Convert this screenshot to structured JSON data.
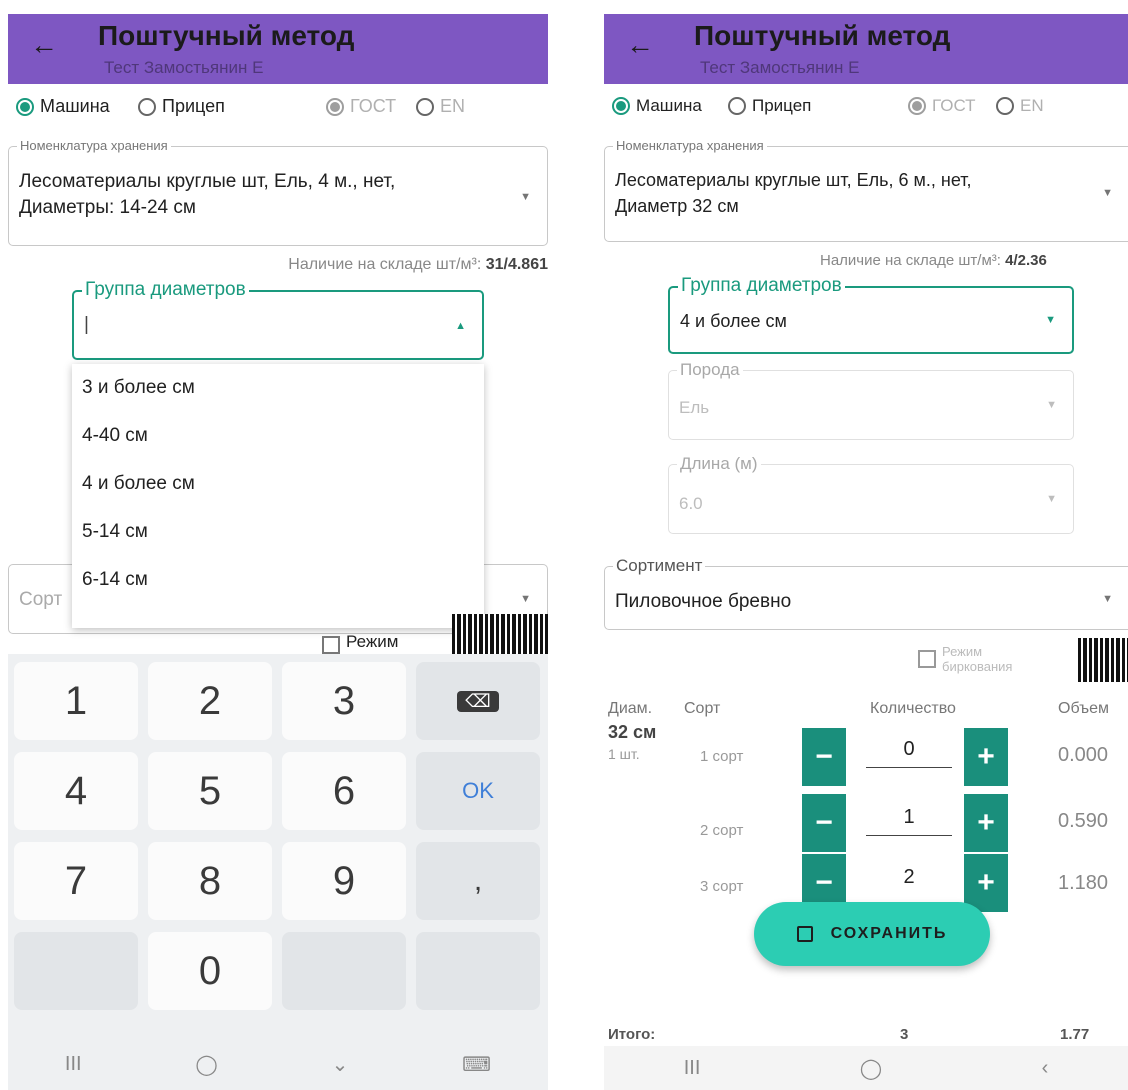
{
  "app": {
    "back_icon": "←",
    "title": "Поштучный метод",
    "subtitle": "Тест Замостьянин Е",
    "accent_color": "#7e57c2",
    "teal_color": "#1a9a7e"
  },
  "radios": {
    "machine": "Машина",
    "trailer": "Прицеп",
    "gost": "ГОСТ",
    "en": "EN"
  },
  "left": {
    "nomenclature_label": "Номенклатура хранения",
    "nomenclature_value": "Лесоматериалы круглые шт, Ель, 4 м., нет, Диаметры: 14-24 см",
    "stock_label": "Наличие на складе шт/м³:",
    "stock_value": "31/4.861",
    "diameter_label": "Группа диаметров",
    "diameter_value": "|",
    "dropdown_options": [
      "3 и более см",
      "4-40 см",
      "4 и более см",
      "5-14 см",
      "6-14 см"
    ],
    "sort_partial": "Сорт",
    "mode_label": "Режим",
    "keys": [
      "1",
      "2",
      "3",
      "4",
      "5",
      "6",
      "7",
      "8",
      "9",
      "0"
    ],
    "ok_key": "OK",
    "comma_key": ",",
    "backspace_icon": "⌫",
    "nav": [
      "III",
      "◯",
      "⌄",
      "⌨"
    ]
  },
  "right": {
    "nomenclature_label": "Номенклатура хранения",
    "nomenclature_value": "Лесоматериалы круглые шт, Ель, 6 м., нет, Диаметр 32 см",
    "stock_label": "Наличие на складе шт/м³:",
    "stock_value": "4/2.36",
    "diameter_label": "Группа диаметров",
    "diameter_value": "4 и более см",
    "species_label": "Порода",
    "species_value": "Ель",
    "length_label": "Длина (м)",
    "length_value": "6.0",
    "assortment_label": "Сортимент",
    "assortment_value": "Пиловочное бревно",
    "mode_label": "Режим биркования",
    "table_headers": {
      "diam": "Диам.",
      "sort": "Сорт",
      "qty": "Количество",
      "vol": "Объем"
    },
    "diam_value": "32 см",
    "diam_count": "1 шт.",
    "rows": [
      {
        "sort": "1 сорт",
        "qty": "0",
        "vol": "0.000"
      },
      {
        "sort": "2 сорт",
        "qty": "1",
        "vol": "0.590"
      },
      {
        "sort": "3 сорт",
        "qty": "2",
        "vol": "1.180"
      }
    ],
    "minus": "−",
    "plus": "+",
    "save_label": "СОХРАНИТЬ",
    "total_label": "Итого:",
    "total_qty": "3",
    "total_vol": "1.77",
    "nav": [
      "III",
      "◯",
      "‹"
    ]
  }
}
